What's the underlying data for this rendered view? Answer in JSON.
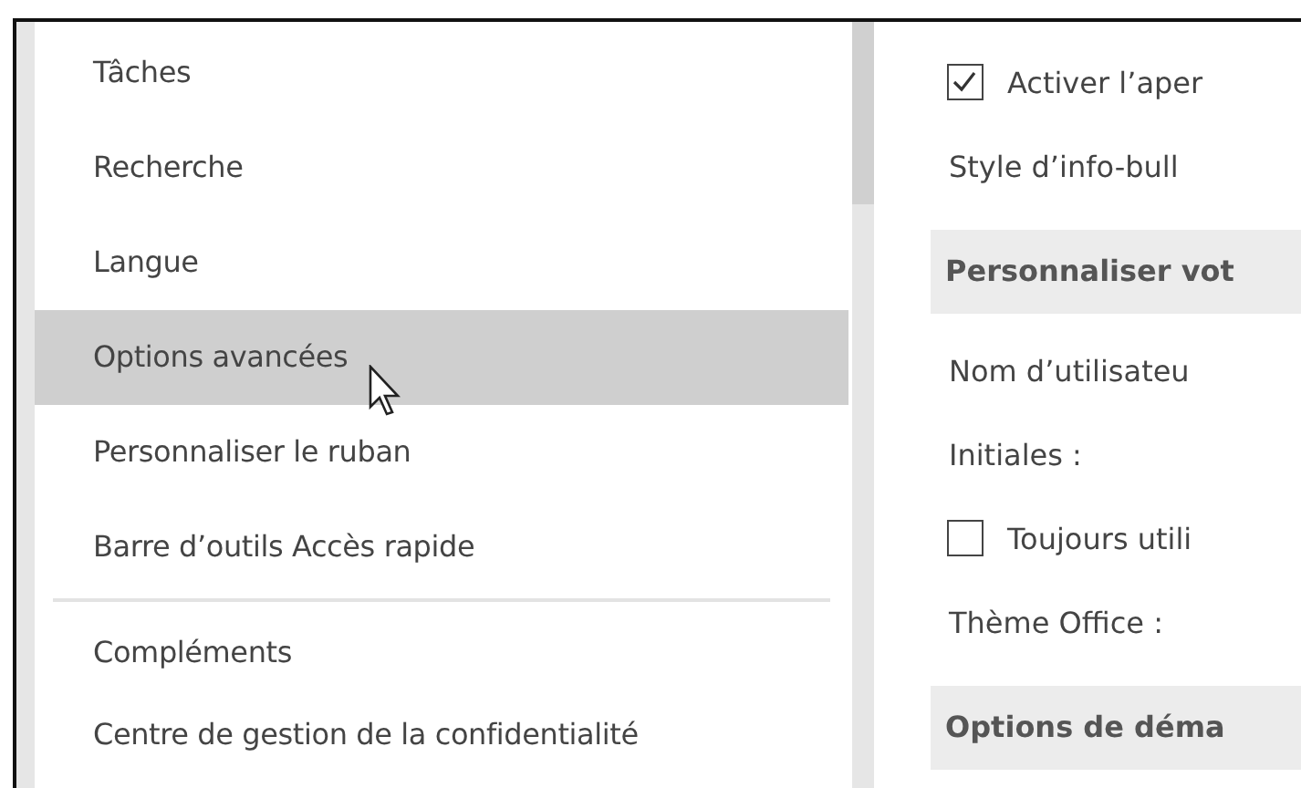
{
  "sidebar": {
    "items": [
      {
        "label": "Tâches",
        "selected": false,
        "separator_before": false
      },
      {
        "label": "Recherche",
        "selected": false,
        "separator_before": false
      },
      {
        "label": "Langue",
        "selected": false,
        "separator_before": false
      },
      {
        "label": "Options avancées",
        "selected": true,
        "separator_before": false
      },
      {
        "label": "Personnaliser le ruban",
        "selected": false,
        "separator_before": false
      },
      {
        "label": "Barre d’outils Accès rapide",
        "selected": false,
        "separator_before": false
      },
      {
        "label": "Compléments",
        "selected": false,
        "separator_before": true
      },
      {
        "label": "Centre de gestion de la confidentialité",
        "selected": false,
        "separator_before": false
      }
    ]
  },
  "options": [
    {
      "kind": "checkbox",
      "label": "Activer l’aper",
      "checked": true
    },
    {
      "kind": "label",
      "label": "Style d’info-bull"
    },
    {
      "kind": "section",
      "label": "Personnaliser vot"
    },
    {
      "kind": "label",
      "label": "Nom d’utilisateu"
    },
    {
      "kind": "label",
      "label": "Initiales :"
    },
    {
      "kind": "checkbox",
      "label": "Toujours utili",
      "checked": false
    },
    {
      "kind": "label",
      "label": "Thème Office :"
    },
    {
      "kind": "section",
      "label": "Options de déma"
    }
  ]
}
